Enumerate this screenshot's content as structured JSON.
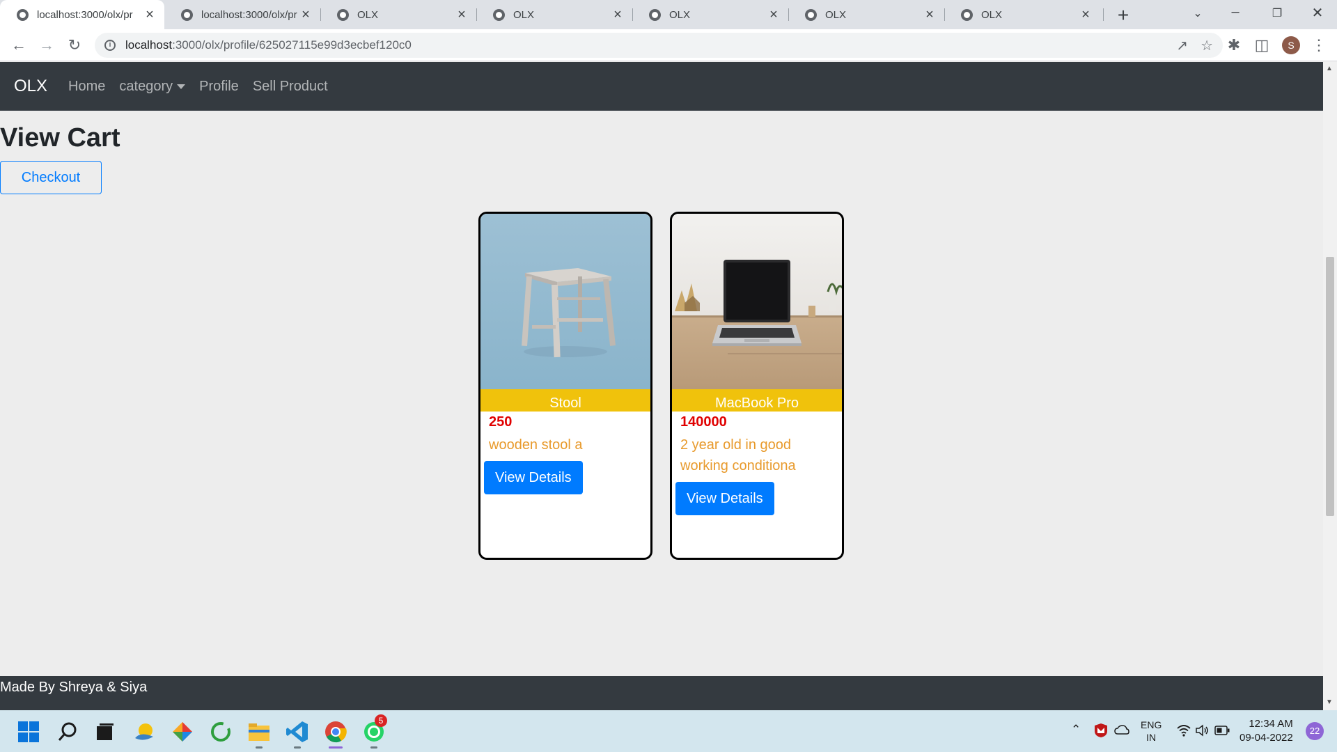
{
  "browser": {
    "tabs": [
      {
        "title": "localhost:3000/olx/pr",
        "active": true
      },
      {
        "title": "localhost:3000/olx/pr",
        "active": false
      },
      {
        "title": "OLX",
        "active": false
      },
      {
        "title": "OLX",
        "active": false
      },
      {
        "title": "OLX",
        "active": false
      },
      {
        "title": "OLX",
        "active": false
      },
      {
        "title": "OLX",
        "active": false
      }
    ],
    "url_host": "localhost",
    "url_path": ":3000/olx/profile/625027115e99d3ecbef120c0",
    "profile_initial": "S"
  },
  "navbar": {
    "brand": "OLX",
    "links": [
      "Home",
      "category",
      "Profile",
      "Sell Product"
    ]
  },
  "page": {
    "title": "View Cart",
    "checkout_label": "Checkout"
  },
  "cart_items": [
    {
      "name": "Stool",
      "price": "250",
      "description": "wooden stool a",
      "button": "View Details"
    },
    {
      "name": "MacBook Pro",
      "price": "140000",
      "description": "2 year old in good working conditiona",
      "button": "View Details"
    }
  ],
  "footer": {
    "text": "Made By Shreya & Siya"
  },
  "taskbar": {
    "whatsapp_badge": "5",
    "language_line1": "ENG",
    "language_line2": "IN",
    "time": "12:34 AM",
    "date": "09-04-2022",
    "notifications": "22"
  },
  "colors": {
    "navbar_bg": "#343a40",
    "primary": "#007bff",
    "card_name_bg": "#f0c20c",
    "price": "#e00000",
    "description": "#e89a2c"
  }
}
